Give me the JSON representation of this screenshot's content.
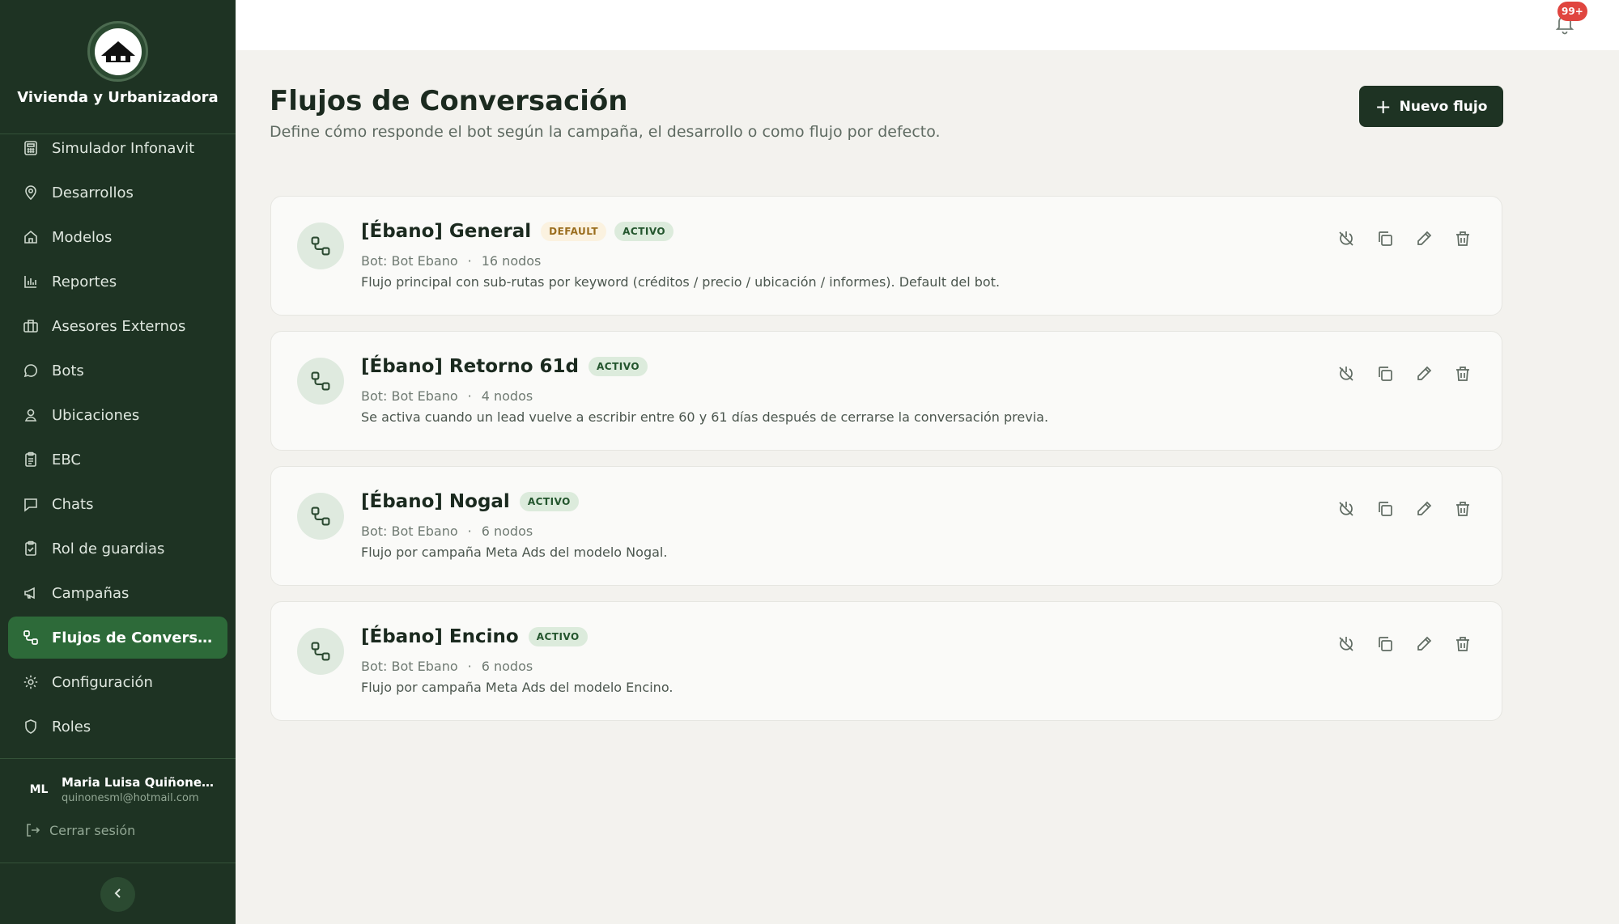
{
  "app": {
    "brand": "Vivienda y Urbanizadora"
  },
  "sidebar": {
    "items": [
      {
        "label": "Simulador Infonavit",
        "icon": "calculator-icon"
      },
      {
        "label": "Desarrollos",
        "icon": "map-pin-icon"
      },
      {
        "label": "Modelos",
        "icon": "home-icon"
      },
      {
        "label": "Reportes",
        "icon": "bar-chart-icon"
      },
      {
        "label": "Asesores Externos",
        "icon": "building-icon"
      },
      {
        "label": "Bots",
        "icon": "chat-bubble-icon"
      },
      {
        "label": "Ubicaciones",
        "icon": "user-pin-icon"
      },
      {
        "label": "EBC",
        "icon": "clipboard-icon"
      },
      {
        "label": "Chats",
        "icon": "message-square-icon"
      },
      {
        "label": "Rol de guardias",
        "icon": "clipboard-check-icon"
      },
      {
        "label": "Campañas",
        "icon": "megaphone-icon"
      },
      {
        "label": "Flujos de Conversaci...",
        "icon": "flow-icon",
        "active": true
      },
      {
        "label": "Configuración",
        "icon": "gear-icon"
      },
      {
        "label": "Roles",
        "icon": "shield-icon"
      }
    ],
    "user": {
      "initials": "ML",
      "name": "Maria Luisa Quiñone...",
      "email": "quinonesml@hotmail.com"
    },
    "logout_label": "Cerrar sesión"
  },
  "topbar": {
    "notification_count": "99+"
  },
  "main": {
    "title": "Flujos de Conversación",
    "subtitle": "Define cómo responde el bot según la campaña, el desarrollo o como flujo por defecto.",
    "new_button_label": "Nuevo flujo"
  },
  "flows": [
    {
      "title": "[Ébano] General",
      "tags": [
        "DEFAULT",
        "ACTIVO"
      ],
      "bot": "Bot: Bot Ebano",
      "nodes": "16 nodos",
      "description": "Flujo principal con sub-rutas por keyword (créditos / precio / ubicación / informes). Default del bot."
    },
    {
      "title": "[Ébano] Retorno 61d",
      "tags": [
        "ACTIVO"
      ],
      "bot": "Bot: Bot Ebano",
      "nodes": "4 nodos",
      "description": "Se activa cuando un lead vuelve a escribir entre 60 y 61 días después de cerrarse la conversación previa."
    },
    {
      "title": "[Ébano] Nogal",
      "tags": [
        "ACTIVO"
      ],
      "bot": "Bot: Bot Ebano",
      "nodes": "6 nodos",
      "description": "Flujo por campaña Meta Ads del modelo Nogal."
    },
    {
      "title": "[Ébano] Encino",
      "tags": [
        "ACTIVO"
      ],
      "bot": "Bot: Bot Ebano",
      "nodes": "6 nodos",
      "description": "Flujo por campaña Meta Ads del modelo Encino."
    }
  ],
  "colors": {
    "sidebar_bg": "#1e3323",
    "sidebar_active": "#2d6a39",
    "page_bg": "#f3f2ee",
    "primary_button": "#1e3323",
    "badge_red": "#e0453f",
    "tag_active_bg": "#dcebdc",
    "tag_default_bg": "#fbf2e0"
  }
}
